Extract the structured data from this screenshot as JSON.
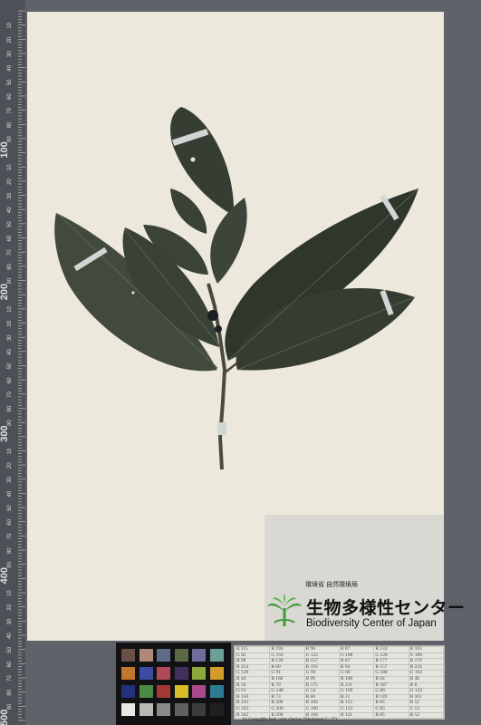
{
  "ruler": {
    "major_labels": [
      "100",
      "200",
      "300",
      "400",
      "500"
    ],
    "minor_labels": [
      "10",
      "20",
      "30",
      "40",
      "50",
      "60",
      "70",
      "80",
      "90"
    ]
  },
  "label": {
    "ministry": "環境省 自然環境局",
    "org_name_jp": "生物多様性センター",
    "org_name_en": "Biodiversity Center of Japan"
  },
  "color_checker": {
    "patches": [
      "#6a5048",
      "#b08878",
      "#5e6c88",
      "#5a6a44",
      "#6e6c9a",
      "#6aa098",
      "#c0782c",
      "#3c4ca0",
      "#b04a5a",
      "#42305c",
      "#8caa3c",
      "#d09c2c",
      "#24307a",
      "#4a8a44",
      "#a43834",
      "#d8bc28",
      "#a84a8c",
      "#2c7c94",
      "#e8e8e4",
      "#b8b8b4",
      "#8a8a88",
      "#606060",
      "#3c3c3c",
      "#202020"
    ],
    "values": [
      [
        "R 115",
        "R 194",
        "R 98",
        "R 87",
        "R 133",
        "R 103"
      ],
      [
        "G 82",
        "G 150",
        "G 122",
        "G 108",
        "G 128",
        "G 189"
      ],
      [
        "B 68",
        "B 130",
        "B 157",
        "B 67",
        "B 177",
        "B 170"
      ],
      [
        "R 214",
        "R 80",
        "R 193",
        "R 94",
        "R 157",
        "R 224"
      ],
      [
        "G 126",
        "G 91",
        "G 90",
        "G 60",
        "G 188",
        "G 163"
      ],
      [
        "B 44",
        "B 166",
        "B 99",
        "B 108",
        "B 64",
        "B 46"
      ],
      [
        "R 56",
        "R 70",
        "R 175",
        "R 231",
        "R 187",
        "R 8"
      ],
      [
        "G 61",
        "G 148",
        "G 54",
        "G 199",
        "G 86",
        "G 133"
      ],
      [
        "B 150",
        "B 73",
        "B 60",
        "B 31",
        "B 149",
        "B 161"
      ],
      [
        "R 243",
        "R 200",
        "R 160",
        "R 122",
        "R 85",
        "R 52"
      ],
      [
        "G 243",
        "G 200",
        "G 160",
        "G 122",
        "G 85",
        "G 52"
      ],
      [
        "B 242",
        "B 200",
        "B 160",
        "B 121",
        "B 85",
        "B 52"
      ]
    ],
    "caption": "by GretagMacbeth color checker (Illuminant C / 2°)"
  },
  "colors": {
    "sheet": "#ece8db",
    "leaf": "#3b4238",
    "leaf_light": "#4a5246",
    "background": "#5f6369"
  }
}
